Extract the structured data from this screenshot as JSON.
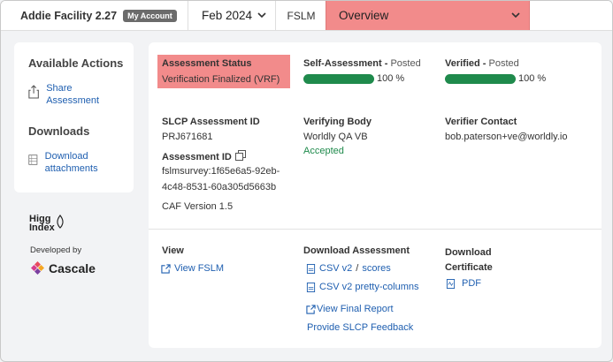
{
  "header": {
    "facility_name": "Addie Facility 2.27",
    "account_badge": "My Account",
    "date_selected": "Feb 2024",
    "module": "FSLM",
    "view_selected": "Overview"
  },
  "sidebar": {
    "actions_title": "Available Actions",
    "share_label": "Share Assessment",
    "downloads_title": "Downloads",
    "download_label": "Download attachments",
    "higg_logo": "Higg Index",
    "developed_by": "Developed by",
    "cascale": "Cascale"
  },
  "assessment": {
    "status_label": "Assessment Status",
    "status_value": "Verification Finalized (VRF)",
    "self_label": "Self-Assessment",
    "self_state": "Posted",
    "self_pct": "100 %",
    "self_progress": 1.0,
    "verified_label": "Verified",
    "verified_state": "Posted",
    "verified_pct": "100 %",
    "verified_progress": 1.0,
    "slcp_id_label": "SLCP Assessment ID",
    "slcp_id_value": "PRJ671681",
    "assessment_id_label": "Assessment ID",
    "assessment_id_line1": "fslmsurvey:1f65e6a5-92eb-",
    "assessment_id_line2": "4c48-8531-60a305d5663b",
    "caf_version": "CAF Version 1.5",
    "verifying_body_label": "Verifying Body",
    "verifying_body_value": "Worldly QA VB",
    "verifying_body_status": "Accepted",
    "verifier_contact_label": "Verifier Contact",
    "verifier_contact_value": "bob.paterson+ve@worldly.io"
  },
  "links": {
    "view_label": "View",
    "view_fslm": "View FSLM",
    "download_assessment_label": "Download Assessment",
    "csv_v2": "CSV v2",
    "slash": "/",
    "scores": "scores",
    "csv_pretty": "CSV v2 pretty-columns",
    "view_final_report": "View Final Report",
    "feedback": "Provide SLCP Feedback",
    "download_certificate_label": "Download Certificate",
    "pdf": "PDF"
  },
  "colors": {
    "accent_red": "#f28b8b",
    "progress_green": "#1f8a4c",
    "link_blue": "#1f5fb0"
  }
}
